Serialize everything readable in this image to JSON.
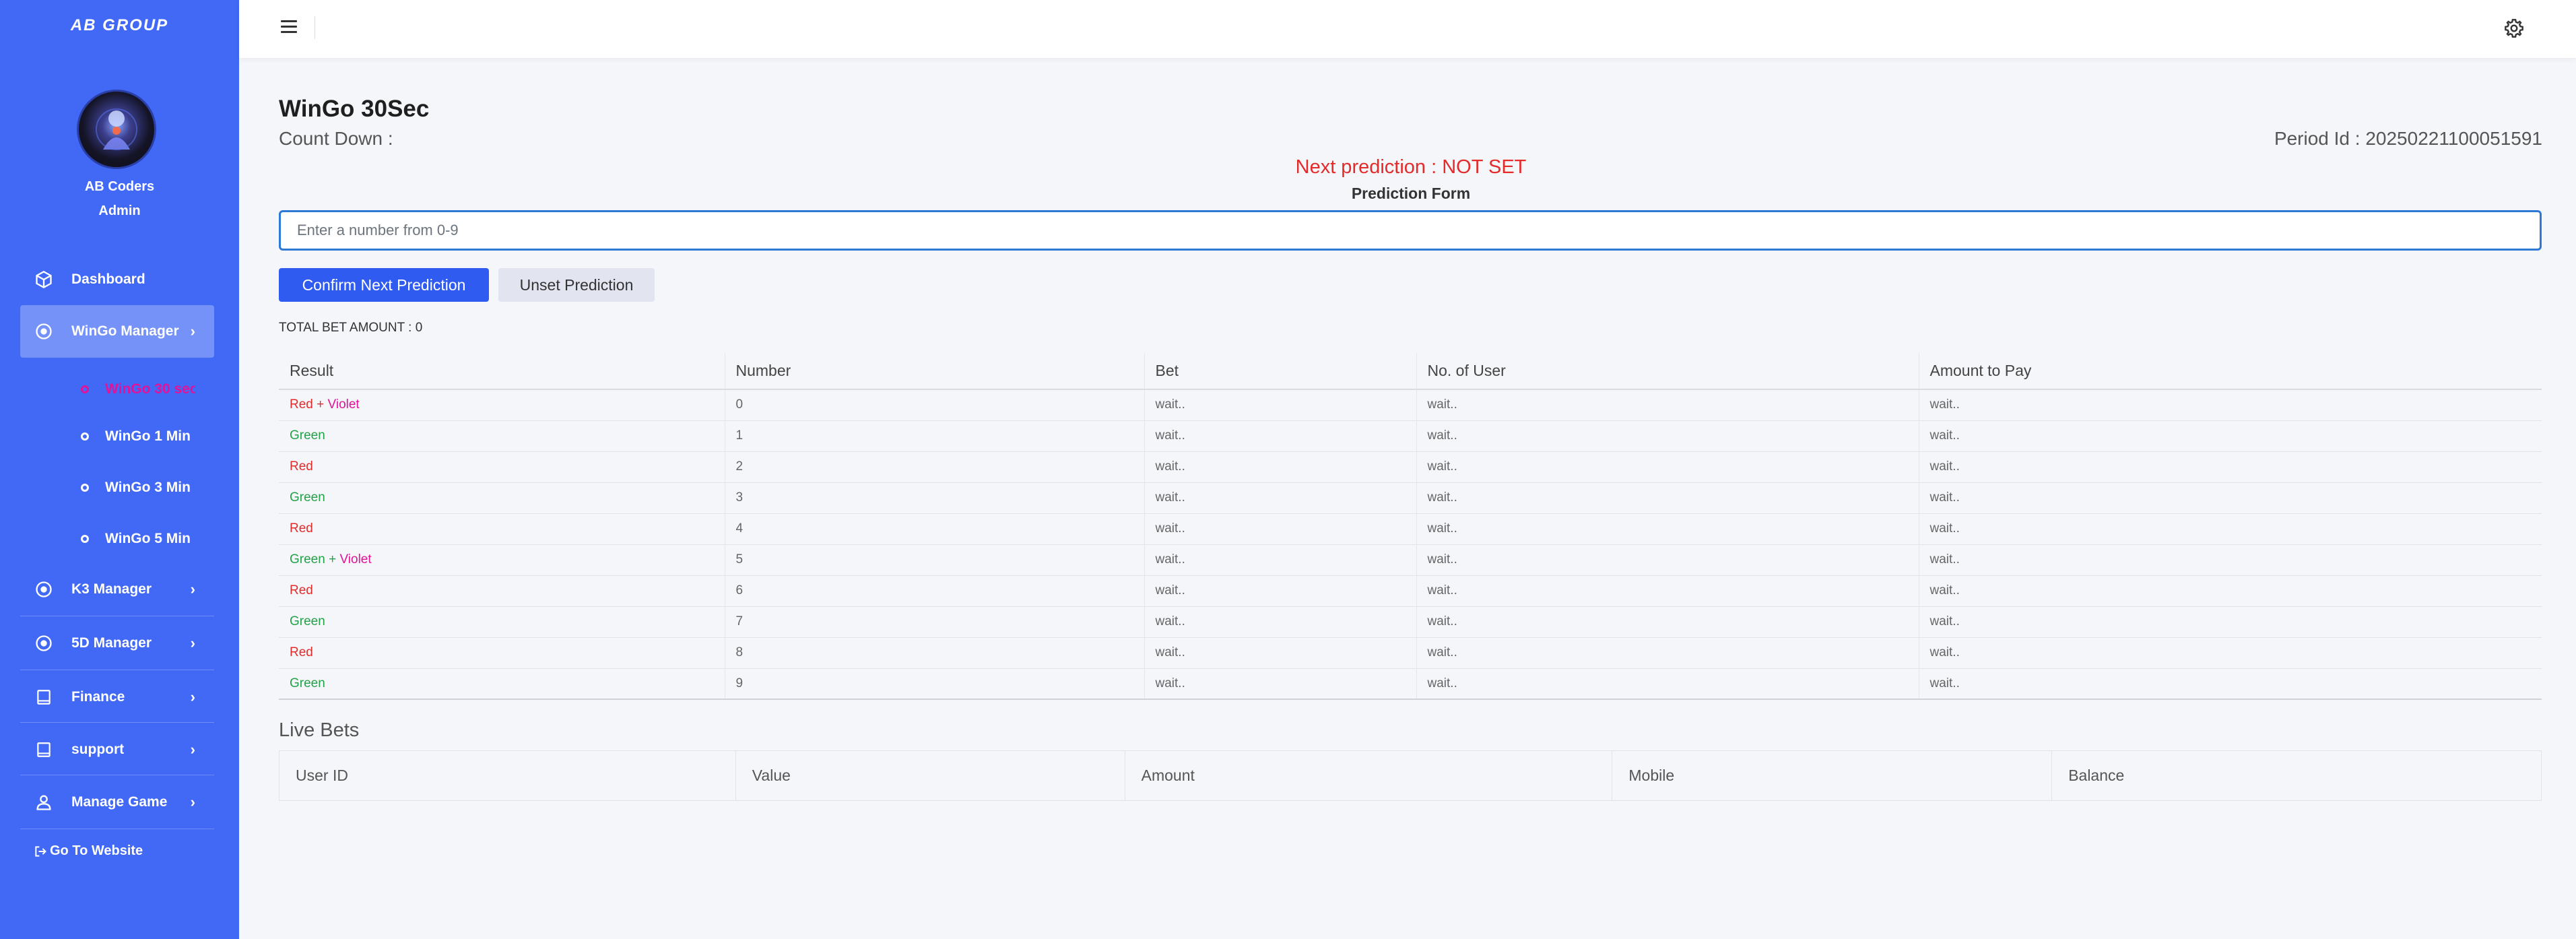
{
  "sidebar": {
    "brand": "AB GROUP",
    "user_name": "AB Coders",
    "user_role": "Admin",
    "nav": {
      "dashboard": "Dashboard",
      "wingo_manager": "WinGo Manager",
      "k3_manager": "K3 Manager",
      "d5_manager": "5D Manager",
      "finance": "Finance",
      "support": "support",
      "manage_game": "Manage Game",
      "go_website": "Go To Website"
    },
    "submenu": [
      "WinGo 30 sec",
      "WinGo 1 Min",
      "WinGo 3 Min",
      "WinGo 5 Min"
    ]
  },
  "main": {
    "title": "WinGo 30Sec",
    "countdown_label": "Count Down :",
    "period_label": "Period Id : 20250221100051591",
    "next_prediction": "Next prediction : NOT SET",
    "prediction_form_label": "Prediction Form",
    "input_placeholder": "Enter a number from 0-9",
    "confirm_button": "Confirm Next Prediction",
    "unset_button": "Unset Prediction",
    "total_bet": "TOTAL BET AMOUNT : 0"
  },
  "results_table": {
    "headers": [
      "Result",
      "Number",
      "Bet",
      "No. of User",
      "Amount to Pay"
    ],
    "rows": [
      {
        "result_a": "Red",
        "result_sep": " + ",
        "result_b": "Violet",
        "number": "0",
        "bet": "wait..",
        "users": "wait..",
        "pay": "wait.."
      },
      {
        "result_a": "Green",
        "result_sep": "",
        "result_b": "",
        "number": "1",
        "bet": "wait..",
        "users": "wait..",
        "pay": "wait.."
      },
      {
        "result_a": "Red",
        "result_sep": "",
        "result_b": "",
        "number": "2",
        "bet": "wait..",
        "users": "wait..",
        "pay": "wait.."
      },
      {
        "result_a": "Green",
        "result_sep": "",
        "result_b": "",
        "number": "3",
        "bet": "wait..",
        "users": "wait..",
        "pay": "wait.."
      },
      {
        "result_a": "Red",
        "result_sep": "",
        "result_b": "",
        "number": "4",
        "bet": "wait..",
        "users": "wait..",
        "pay": "wait.."
      },
      {
        "result_a": "Green",
        "result_sep": " + ",
        "result_b": "Violet",
        "number": "5",
        "bet": "wait..",
        "users": "wait..",
        "pay": "wait.."
      },
      {
        "result_a": "Red",
        "result_sep": "",
        "result_b": "",
        "number": "6",
        "bet": "wait..",
        "users": "wait..",
        "pay": "wait.."
      },
      {
        "result_a": "Green",
        "result_sep": "",
        "result_b": "",
        "number": "7",
        "bet": "wait..",
        "users": "wait..",
        "pay": "wait.."
      },
      {
        "result_a": "Red",
        "result_sep": "",
        "result_b": "",
        "number": "8",
        "bet": "wait..",
        "users": "wait..",
        "pay": "wait.."
      },
      {
        "result_a": "Green",
        "result_sep": "",
        "result_b": "",
        "number": "9",
        "bet": "wait..",
        "users": "wait..",
        "pay": "wait.."
      }
    ]
  },
  "live_bets": {
    "title": "Live Bets",
    "headers": [
      "User ID",
      "Value",
      "Amount",
      "Mobile",
      "Balance"
    ]
  },
  "colors": {
    "sidebar": "#4169f5",
    "primary_button": "#2f5bf0",
    "red": "#e32b2b",
    "green": "#24a148",
    "violet": "#e0139a"
  },
  "icons": {
    "menu": "hamburger-icon",
    "settings": "gear-icon",
    "dashboard": "cube-icon",
    "manager": "target-icon",
    "finance": "book-icon",
    "support": "book-icon",
    "manage_game": "user-icon",
    "website": "sign-out-icon"
  }
}
